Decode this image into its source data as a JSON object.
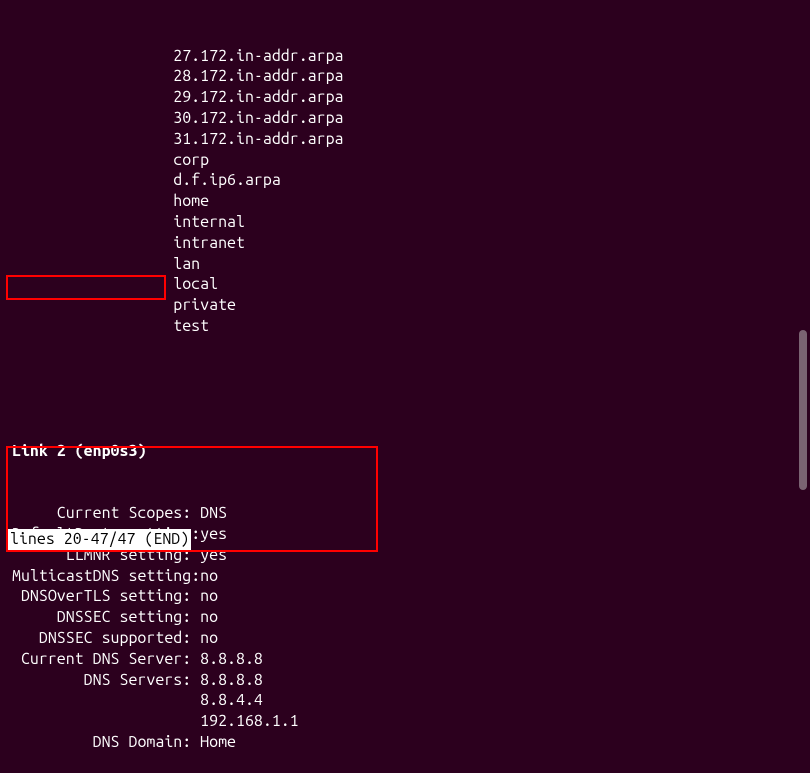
{
  "domains_partial": [
    "27.172.in-addr.arpa",
    "28.172.in-addr.arpa",
    "29.172.in-addr.arpa",
    "30.172.in-addr.arpa",
    "31.172.in-addr.arpa",
    "corp",
    "d.f.ip6.arpa",
    "home",
    "internal",
    "intranet",
    "lan",
    "local",
    "private",
    "test"
  ],
  "link_header": "Link 2 (enp0s3)",
  "settings": [
    {
      "label": "Current Scopes:",
      "value": "DNS"
    },
    {
      "label": "DefaultRoute setting:",
      "value": "yes"
    },
    {
      "label": "LLMNR setting:",
      "value": "yes"
    },
    {
      "label": "MulticastDNS setting:",
      "value": "no"
    },
    {
      "label": "DNSOverTLS setting:",
      "value": "no"
    },
    {
      "label": "DNSSEC setting:",
      "value": "no"
    },
    {
      "label": "DNSSEC supported:",
      "value": "no"
    },
    {
      "label": "Current DNS Server:",
      "value": "8.8.8.8"
    },
    {
      "label": "DNS Servers:",
      "value": "8.8.8.8"
    },
    {
      "label": "",
      "value": "8.8.4.4"
    },
    {
      "label": "",
      "value": "192.168.1.1"
    },
    {
      "label": "DNS Domain:",
      "value": "Home"
    }
  ],
  "status": "lines 20-47/47 (END)"
}
